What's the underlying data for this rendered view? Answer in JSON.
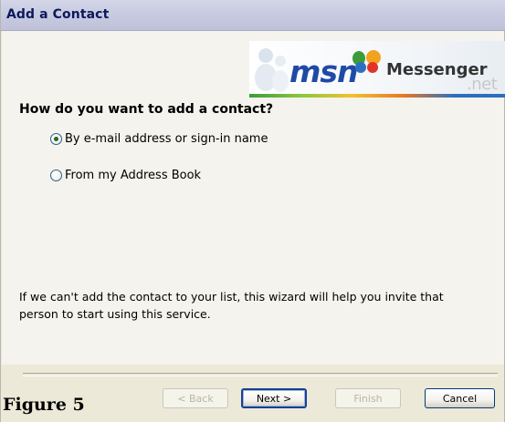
{
  "window": {
    "title": "Add a Contact"
  },
  "logo": {
    "brand": "msn",
    "product": "Messenger",
    "suffix": ".net"
  },
  "question": "How do you want to add a contact?",
  "options": [
    {
      "label": "By e-mail address or sign-in name",
      "selected": true
    },
    {
      "label": "From my Address Book",
      "selected": false
    }
  ],
  "info_text": "If we can't add the contact to your list, this wizard will help you invite that person to start using this service.",
  "buttons": {
    "back": "< Back",
    "next": "Next >",
    "finish": "Finish",
    "cancel": "Cancel"
  },
  "caption": "Figure 5",
  "colors": {
    "title_text": "#0b1a5c",
    "msn_blue": "#1f4aa6",
    "default_button_border": "#1b3f8e"
  }
}
